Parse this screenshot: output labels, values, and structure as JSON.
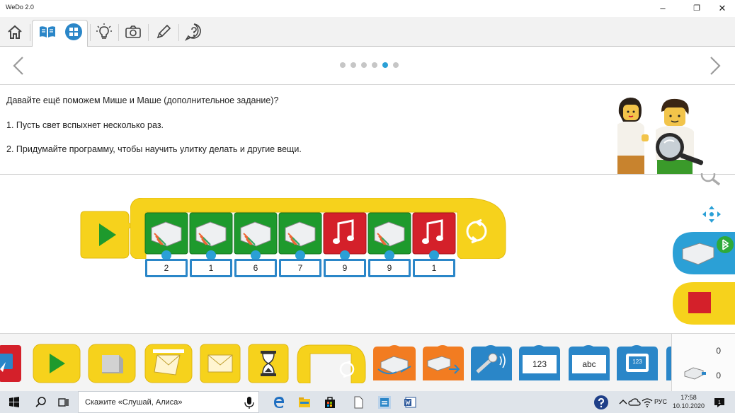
{
  "window": {
    "title": "WeDo 2.0",
    "minimize": "–",
    "restore": "❐",
    "close": "✕"
  },
  "toolbar": {
    "items": [
      "home-icon",
      "book-icon",
      "grid-icon",
      "bulb-icon",
      "camera-icon",
      "pencil-icon",
      "help-icon"
    ]
  },
  "pagination": {
    "total": 6,
    "active": 5
  },
  "instructions": {
    "line1": "Давайте ещё поможем Мише и Маше (дополнительное задание)?",
    "line2": "1. Пусть свет вспыхнет несколько раз.",
    "line3": "2. Придумайте программу, чтобы научить улитку делать и другие вещи."
  },
  "program": {
    "blocks": [
      {
        "type": "light",
        "value": "2"
      },
      {
        "type": "light",
        "value": "1"
      },
      {
        "type": "light",
        "value": "6"
      },
      {
        "type": "light",
        "value": "7"
      },
      {
        "type": "sound",
        "value": "9"
      },
      {
        "type": "light",
        "value": "9"
      },
      {
        "type": "sound",
        "value": "1"
      }
    ]
  },
  "palette": {
    "number_label": "123",
    "text_label": "abc",
    "display_label": "123"
  },
  "counters": {
    "first": "0",
    "second": "0"
  },
  "taskbar": {
    "search_placeholder": "Скажите «Слушай, Алиса»",
    "lang": "РУС",
    "time": "17:58",
    "date": "10.10.2020"
  },
  "colors": {
    "green": "#1e9a2d",
    "red": "#d4202a",
    "yellow": "#f6d21c",
    "blue": "#2a86c8",
    "accent": "#2ba0d6"
  }
}
